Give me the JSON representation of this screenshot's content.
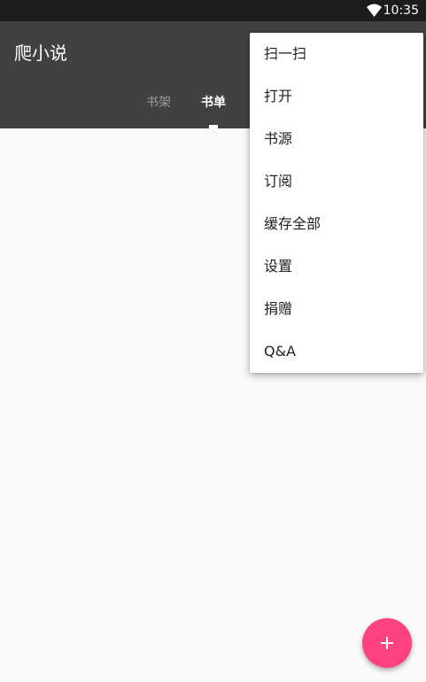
{
  "status_bar": {
    "time": "10:35",
    "wifi_icon": "wifi-icon"
  },
  "app_bar": {
    "title": "爬小说",
    "tabs": [
      {
        "label": "书架",
        "selected": false
      },
      {
        "label": "书单",
        "selected": true
      }
    ]
  },
  "overflow_menu": {
    "items": [
      {
        "label": "扫一扫"
      },
      {
        "label": "打开"
      },
      {
        "label": "书源"
      },
      {
        "label": "订阅"
      },
      {
        "label": "缓存全部"
      },
      {
        "label": "设置"
      },
      {
        "label": "捐赠"
      },
      {
        "label": "Q&A"
      }
    ]
  },
  "fab": {
    "icon": "plus-icon",
    "color": "#ff4081"
  },
  "colors": {
    "app_bar": "#414141",
    "status_bar": "#1c1c1c",
    "background": "#fafafa",
    "accent": "#ff4081"
  }
}
